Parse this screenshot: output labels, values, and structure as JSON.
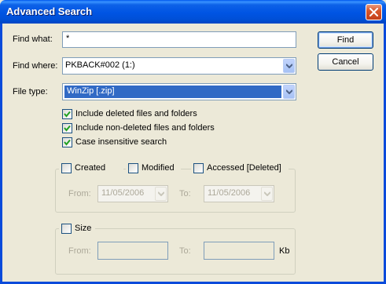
{
  "window": {
    "title": "Advanced Search",
    "close_label": "close"
  },
  "find_what": {
    "label": "Find what:",
    "value": "*"
  },
  "find_where": {
    "label": "Find where:",
    "value": "PKBACK#002 (1:)"
  },
  "file_type": {
    "label": "File type:",
    "value": "WinZip  [.zip]"
  },
  "buttons": {
    "find": "Find",
    "cancel": "Cancel"
  },
  "options": [
    {
      "label": "Include deleted files and folders",
      "checked": true
    },
    {
      "label": "Include non-deleted files and folders",
      "checked": true
    },
    {
      "label": "Case insensitive search",
      "checked": true
    }
  ],
  "date_filter": {
    "created": {
      "label": "Created",
      "checked": false
    },
    "modified": {
      "label": "Modified",
      "checked": false
    },
    "accessed": {
      "label": "Accessed [Deleted]",
      "checked": false
    },
    "from_label": "From:",
    "to_label": "To:",
    "from_value": "11/05/2006",
    "to_value": "11/05/2006"
  },
  "size_filter": {
    "size": {
      "label": "Size",
      "checked": false
    },
    "from_label": "From:",
    "to_label": "To:",
    "unit": "Kb",
    "from_value": "",
    "to_value": ""
  },
  "colors": {
    "titlebar": "#0054E3",
    "dialog_bg": "#ECE9D8",
    "selection": "#316AC5"
  }
}
